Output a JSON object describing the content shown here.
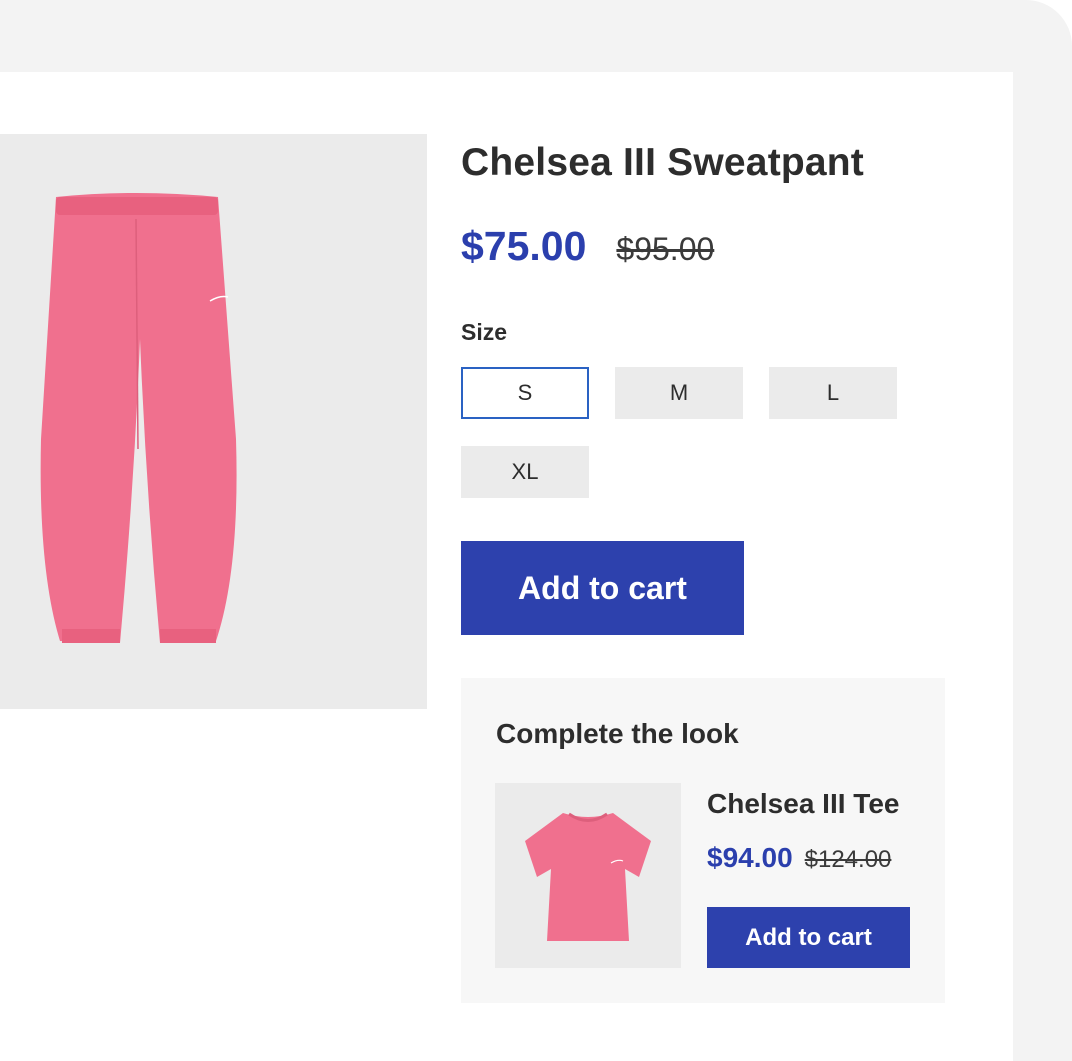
{
  "product": {
    "title": "Chelsea III Sweatpant",
    "price": "$75.00",
    "old_price": "$95.00",
    "image_icon": "pink-sweatpants-image"
  },
  "size": {
    "label": "Size",
    "options": [
      "S",
      "M",
      "L",
      "XL"
    ],
    "selected": "S"
  },
  "cart": {
    "add_label": "Add to cart"
  },
  "complete_look": {
    "title": "Complete the look",
    "item": {
      "name": "Chelsea III Tee",
      "price": "$94.00",
      "old_price": "$124.00",
      "add_label": "Add to cart",
      "image_icon": "pink-tshirt-image"
    }
  },
  "colors": {
    "accent": "#2d41ad",
    "selected_border": "#2a62c3",
    "product_pink": "#f0708e"
  }
}
